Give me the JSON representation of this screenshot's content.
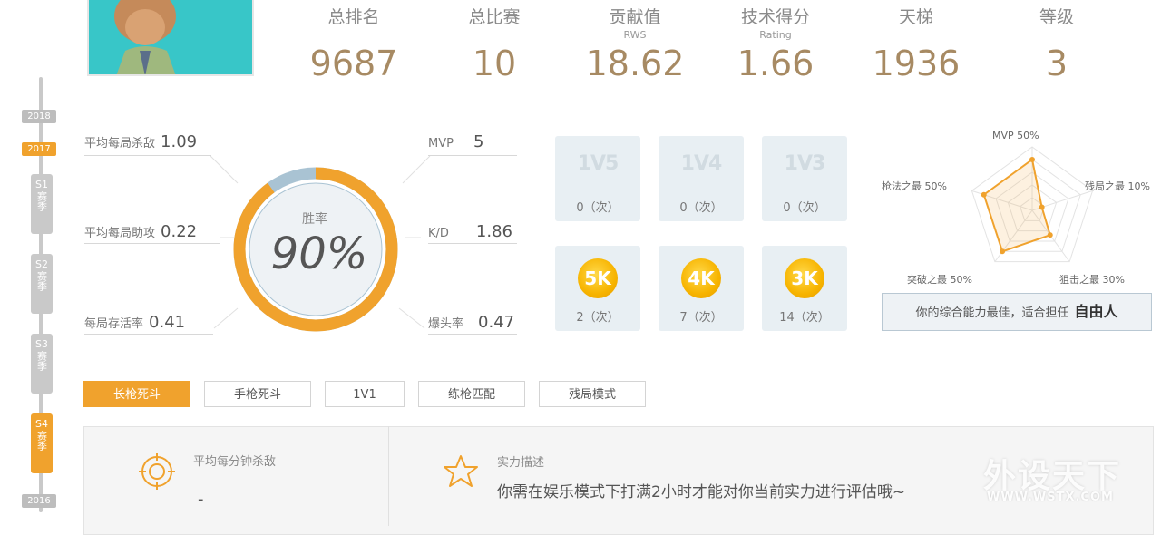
{
  "timeline": {
    "years": [
      "2018",
      "2017",
      "2016"
    ],
    "active_year": "2017",
    "seasons": [
      {
        "code": "S1",
        "text": "赛季"
      },
      {
        "code": "S2",
        "text": "赛季"
      },
      {
        "code": "S3",
        "text": "赛季"
      },
      {
        "code": "S4",
        "text": "赛季"
      }
    ],
    "active_season": "S4"
  },
  "header": {
    "stats": [
      {
        "label": "总排名",
        "sub": "",
        "value": "9687"
      },
      {
        "label": "总比赛",
        "sub": "",
        "value": "10"
      },
      {
        "label": "贡献值",
        "sub": "RWS",
        "value": "18.62"
      },
      {
        "label": "技术得分",
        "sub": "Rating",
        "value": "1.66"
      },
      {
        "label": "天梯",
        "sub": "",
        "value": "1936"
      },
      {
        "label": "等级",
        "sub": "",
        "value": "3"
      }
    ]
  },
  "stats_left": [
    {
      "label": "平均每局杀敌",
      "value": "1.09"
    },
    {
      "label": "平均每局助攻",
      "value": "0.22"
    },
    {
      "label": "每局存活率",
      "value": "0.41"
    }
  ],
  "stats_right": [
    {
      "label": "MVP",
      "value": "5"
    },
    {
      "label": "K/D",
      "value": "1.86"
    },
    {
      "label": "爆头率",
      "value": "0.47"
    }
  ],
  "winrate": {
    "label": "胜率",
    "value": "90%",
    "fraction": 0.9
  },
  "badges": {
    "clutch": [
      {
        "name": "1V5",
        "count": "0（次）"
      },
      {
        "name": "1V4",
        "count": "0（次）"
      },
      {
        "name": "1V3",
        "count": "0（次）"
      }
    ],
    "multikill": [
      {
        "name": "5K",
        "count": "2（次）"
      },
      {
        "name": "4K",
        "count": "7（次）"
      },
      {
        "name": "3K",
        "count": "14（次）"
      }
    ]
  },
  "radar": {
    "labels": [
      "MVP 50%",
      "残局之最 10%",
      "狙击之最 30%",
      "突破之最 50%",
      "枪法之最 50%"
    ],
    "values": [
      0.5,
      0.1,
      0.3,
      0.5,
      0.5
    ],
    "accent": "#f0a22d"
  },
  "best_role": {
    "text": "你的综合能力最佳，适合担任",
    "role": "自由人"
  },
  "tabs": [
    "长枪死斗",
    "手枪死斗",
    "1V1",
    "练枪匹配",
    "残局模式"
  ],
  "active_tab": "长枪死斗",
  "bottom": {
    "kpm_label": "平均每分钟杀敌",
    "kpm_value": "-",
    "desc_label": "实力描述",
    "desc_text": "你需在娱乐模式下打满2小时才能对你当前实力进行评估哦~"
  },
  "watermark": {
    "title": "外设天下",
    "url": "WWW.WSTX.COM"
  },
  "colors": {
    "accent": "#f0a22d",
    "value": "#a78a63",
    "badge_bg": "#e8eff3"
  }
}
